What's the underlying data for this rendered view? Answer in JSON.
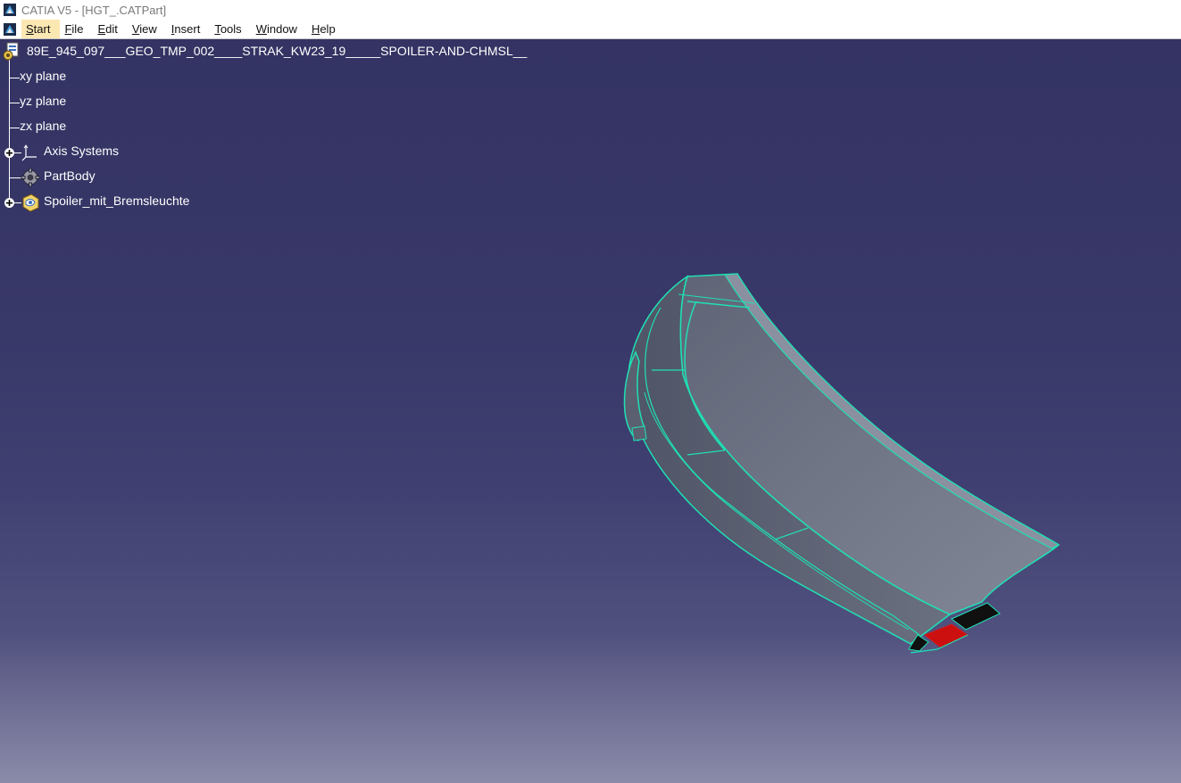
{
  "window": {
    "title": "CATIA V5 - [HGT_.CATPart]"
  },
  "menu": {
    "items": [
      {
        "key": "S",
        "rest": "tart"
      },
      {
        "key": "F",
        "rest": "ile"
      },
      {
        "key": "E",
        "rest": "dit"
      },
      {
        "key": "V",
        "rest": "iew"
      },
      {
        "key": "I",
        "rest": "nsert"
      },
      {
        "key": "T",
        "rest": "ools"
      },
      {
        "key": "W",
        "rest": "indow"
      },
      {
        "key": "H",
        "rest": "elp"
      }
    ],
    "active_index": 0
  },
  "tree": {
    "root": "89E_945_097___GEO_TMP_002____STRAK_KW23_19_____SPOILER-AND-CHMSL__",
    "items": [
      {
        "label": "xy plane",
        "icon": "plane-icon",
        "expandable": false
      },
      {
        "label": "yz plane",
        "icon": "plane-icon",
        "expandable": false
      },
      {
        "label": "zx plane",
        "icon": "plane-icon",
        "expandable": false
      },
      {
        "label": "Axis Systems",
        "icon": "axis-system-icon",
        "expandable": true
      },
      {
        "label": "PartBody",
        "icon": "part-body-icon",
        "expandable": false
      },
      {
        "label": "Spoiler_mit_Bremsleuchte",
        "icon": "geometrical-set-icon",
        "expandable": true
      }
    ]
  },
  "colors": {
    "viewport_top": "#343363",
    "viewport_bottom": "#8a8aa9",
    "edge": "#1fe0b5",
    "surface": "#6e7484",
    "brake_light": "#cc1010",
    "black_part": "#101010",
    "menu_highlight": "#fbe7b2"
  }
}
